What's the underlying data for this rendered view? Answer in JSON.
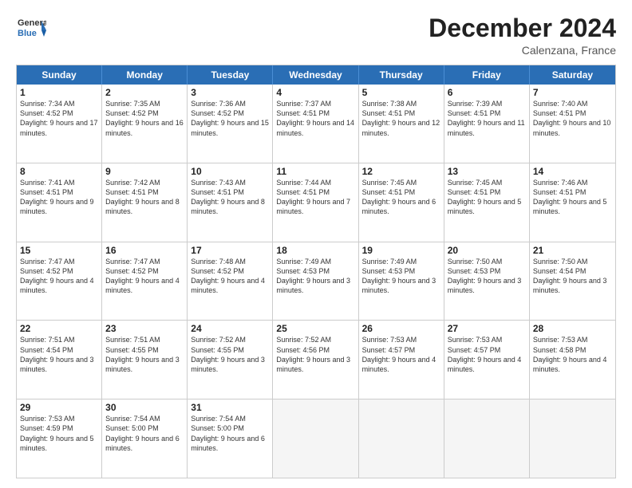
{
  "logo": {
    "general": "General",
    "blue": "Blue"
  },
  "header": {
    "month": "December 2024",
    "location": "Calenzana, France"
  },
  "weekdays": [
    "Sunday",
    "Monday",
    "Tuesday",
    "Wednesday",
    "Thursday",
    "Friday",
    "Saturday"
  ],
  "rows": [
    [
      {
        "day": "1",
        "sunrise": "Sunrise: 7:34 AM",
        "sunset": "Sunset: 4:52 PM",
        "daylight": "Daylight: 9 hours and 17 minutes."
      },
      {
        "day": "2",
        "sunrise": "Sunrise: 7:35 AM",
        "sunset": "Sunset: 4:52 PM",
        "daylight": "Daylight: 9 hours and 16 minutes."
      },
      {
        "day": "3",
        "sunrise": "Sunrise: 7:36 AM",
        "sunset": "Sunset: 4:52 PM",
        "daylight": "Daylight: 9 hours and 15 minutes."
      },
      {
        "day": "4",
        "sunrise": "Sunrise: 7:37 AM",
        "sunset": "Sunset: 4:51 PM",
        "daylight": "Daylight: 9 hours and 14 minutes."
      },
      {
        "day": "5",
        "sunrise": "Sunrise: 7:38 AM",
        "sunset": "Sunset: 4:51 PM",
        "daylight": "Daylight: 9 hours and 12 minutes."
      },
      {
        "day": "6",
        "sunrise": "Sunrise: 7:39 AM",
        "sunset": "Sunset: 4:51 PM",
        "daylight": "Daylight: 9 hours and 11 minutes."
      },
      {
        "day": "7",
        "sunrise": "Sunrise: 7:40 AM",
        "sunset": "Sunset: 4:51 PM",
        "daylight": "Daylight: 9 hours and 10 minutes."
      }
    ],
    [
      {
        "day": "8",
        "sunrise": "Sunrise: 7:41 AM",
        "sunset": "Sunset: 4:51 PM",
        "daylight": "Daylight: 9 hours and 9 minutes."
      },
      {
        "day": "9",
        "sunrise": "Sunrise: 7:42 AM",
        "sunset": "Sunset: 4:51 PM",
        "daylight": "Daylight: 9 hours and 8 minutes."
      },
      {
        "day": "10",
        "sunrise": "Sunrise: 7:43 AM",
        "sunset": "Sunset: 4:51 PM",
        "daylight": "Daylight: 9 hours and 8 minutes."
      },
      {
        "day": "11",
        "sunrise": "Sunrise: 7:44 AM",
        "sunset": "Sunset: 4:51 PM",
        "daylight": "Daylight: 9 hours and 7 minutes."
      },
      {
        "day": "12",
        "sunrise": "Sunrise: 7:45 AM",
        "sunset": "Sunset: 4:51 PM",
        "daylight": "Daylight: 9 hours and 6 minutes."
      },
      {
        "day": "13",
        "sunrise": "Sunrise: 7:45 AM",
        "sunset": "Sunset: 4:51 PM",
        "daylight": "Daylight: 9 hours and 5 minutes."
      },
      {
        "day": "14",
        "sunrise": "Sunrise: 7:46 AM",
        "sunset": "Sunset: 4:51 PM",
        "daylight": "Daylight: 9 hours and 5 minutes."
      }
    ],
    [
      {
        "day": "15",
        "sunrise": "Sunrise: 7:47 AM",
        "sunset": "Sunset: 4:52 PM",
        "daylight": "Daylight: 9 hours and 4 minutes."
      },
      {
        "day": "16",
        "sunrise": "Sunrise: 7:47 AM",
        "sunset": "Sunset: 4:52 PM",
        "daylight": "Daylight: 9 hours and 4 minutes."
      },
      {
        "day": "17",
        "sunrise": "Sunrise: 7:48 AM",
        "sunset": "Sunset: 4:52 PM",
        "daylight": "Daylight: 9 hours and 4 minutes."
      },
      {
        "day": "18",
        "sunrise": "Sunrise: 7:49 AM",
        "sunset": "Sunset: 4:53 PM",
        "daylight": "Daylight: 9 hours and 3 minutes."
      },
      {
        "day": "19",
        "sunrise": "Sunrise: 7:49 AM",
        "sunset": "Sunset: 4:53 PM",
        "daylight": "Daylight: 9 hours and 3 minutes."
      },
      {
        "day": "20",
        "sunrise": "Sunrise: 7:50 AM",
        "sunset": "Sunset: 4:53 PM",
        "daylight": "Daylight: 9 hours and 3 minutes."
      },
      {
        "day": "21",
        "sunrise": "Sunrise: 7:50 AM",
        "sunset": "Sunset: 4:54 PM",
        "daylight": "Daylight: 9 hours and 3 minutes."
      }
    ],
    [
      {
        "day": "22",
        "sunrise": "Sunrise: 7:51 AM",
        "sunset": "Sunset: 4:54 PM",
        "daylight": "Daylight: 9 hours and 3 minutes."
      },
      {
        "day": "23",
        "sunrise": "Sunrise: 7:51 AM",
        "sunset": "Sunset: 4:55 PM",
        "daylight": "Daylight: 9 hours and 3 minutes."
      },
      {
        "day": "24",
        "sunrise": "Sunrise: 7:52 AM",
        "sunset": "Sunset: 4:55 PM",
        "daylight": "Daylight: 9 hours and 3 minutes."
      },
      {
        "day": "25",
        "sunrise": "Sunrise: 7:52 AM",
        "sunset": "Sunset: 4:56 PM",
        "daylight": "Daylight: 9 hours and 3 minutes."
      },
      {
        "day": "26",
        "sunrise": "Sunrise: 7:53 AM",
        "sunset": "Sunset: 4:57 PM",
        "daylight": "Daylight: 9 hours and 4 minutes."
      },
      {
        "day": "27",
        "sunrise": "Sunrise: 7:53 AM",
        "sunset": "Sunset: 4:57 PM",
        "daylight": "Daylight: 9 hours and 4 minutes."
      },
      {
        "day": "28",
        "sunrise": "Sunrise: 7:53 AM",
        "sunset": "Sunset: 4:58 PM",
        "daylight": "Daylight: 9 hours and 4 minutes."
      }
    ],
    [
      {
        "day": "29",
        "sunrise": "Sunrise: 7:53 AM",
        "sunset": "Sunset: 4:59 PM",
        "daylight": "Daylight: 9 hours and 5 minutes."
      },
      {
        "day": "30",
        "sunrise": "Sunrise: 7:54 AM",
        "sunset": "Sunset: 5:00 PM",
        "daylight": "Daylight: 9 hours and 6 minutes."
      },
      {
        "day": "31",
        "sunrise": "Sunrise: 7:54 AM",
        "sunset": "Sunset: 5:00 PM",
        "daylight": "Daylight: 9 hours and 6 minutes."
      },
      null,
      null,
      null,
      null
    ]
  ]
}
